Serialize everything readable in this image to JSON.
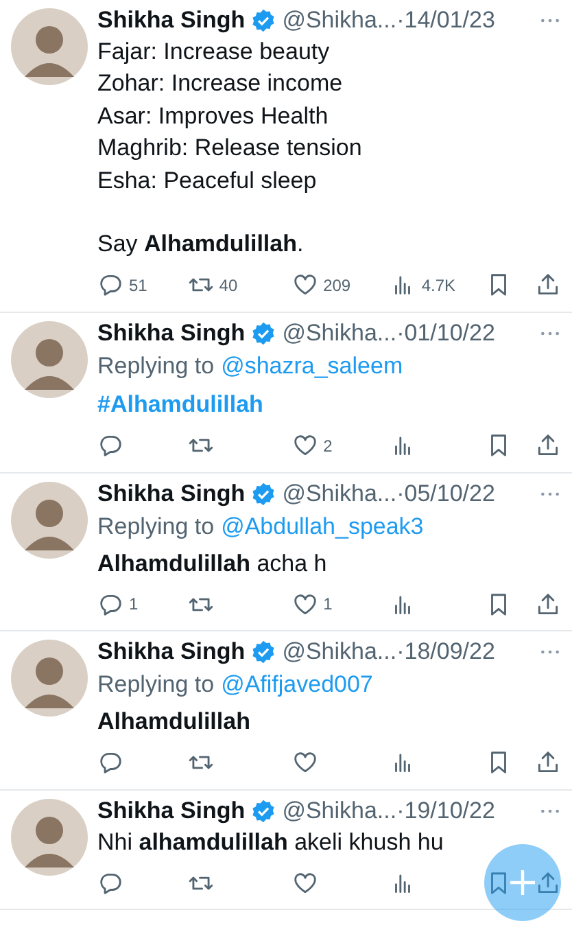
{
  "tweets": [
    {
      "name": "Shikha Singh",
      "verified": true,
      "handle": "@Shikha...",
      "date": "·14/01/23",
      "body": {
        "kind": "text",
        "text": "Fajar: Increase beauty\nZohar: Increase income\nAsar: Improves Health\nMaghrib: Release tension\nEsha: Peaceful sleep\n\nSay **Alhamdulillah**."
      },
      "actions": [
        {
          "kind": "reply",
          "count": "51"
        },
        {
          "kind": "retweet",
          "count": "40"
        },
        {
          "kind": "like",
          "count": "209"
        },
        {
          "kind": "views",
          "count": "4.7K"
        },
        {
          "kind": "bookmark"
        },
        {
          "kind": "share"
        }
      ]
    },
    {
      "name": "Shikha Singh",
      "verified": true,
      "handle": "@Shikha...",
      "date": "·01/10/22",
      "replying_label": "Replying to",
      "replying_to": "@shazra_saleem",
      "body": {
        "kind": "hashtag",
        "text": "#Alhamdulillah"
      },
      "actions": [
        {
          "kind": "reply"
        },
        {
          "kind": "retweet"
        },
        {
          "kind": "like",
          "count": "2"
        },
        {
          "kind": "views"
        },
        {
          "kind": "bookmark"
        },
        {
          "kind": "share"
        }
      ]
    },
    {
      "name": "Shikha Singh",
      "verified": true,
      "handle": "@Shikha...",
      "date": "·05/10/22",
      "replying_label": "Replying to",
      "replying_to": "@Abdullah_speak3",
      "body": {
        "kind": "text",
        "text": "**Alhamdulillah** acha h"
      },
      "actions": [
        {
          "kind": "reply",
          "count": "1"
        },
        {
          "kind": "retweet"
        },
        {
          "kind": "like",
          "count": "1"
        },
        {
          "kind": "views"
        },
        {
          "kind": "bookmark"
        },
        {
          "kind": "share"
        }
      ]
    },
    {
      "name": "Shikha Singh",
      "verified": true,
      "handle": "@Shikha...",
      "date": "·18/09/22",
      "replying_label": "Replying to",
      "replying_to": "@Afifjaved007",
      "body": {
        "kind": "text",
        "text": "**Alhamdulillah**"
      },
      "actions": [
        {
          "kind": "reply"
        },
        {
          "kind": "retweet"
        },
        {
          "kind": "like"
        },
        {
          "kind": "views"
        },
        {
          "kind": "bookmark"
        },
        {
          "kind": "share"
        }
      ]
    },
    {
      "name": "Shikha Singh",
      "verified": true,
      "handle": "@Shikha...",
      "date": "·19/10/22",
      "body": {
        "kind": "text",
        "text": "Nhi **alhamdulillah** akeli khush hu"
      },
      "actions": [
        {
          "kind": "reply"
        },
        {
          "kind": "retweet"
        },
        {
          "kind": "like"
        },
        {
          "kind": "views"
        },
        {
          "kind": "bookmark"
        },
        {
          "kind": "share"
        }
      ]
    }
  ],
  "compose_button": {
    "kind": "plus"
  }
}
